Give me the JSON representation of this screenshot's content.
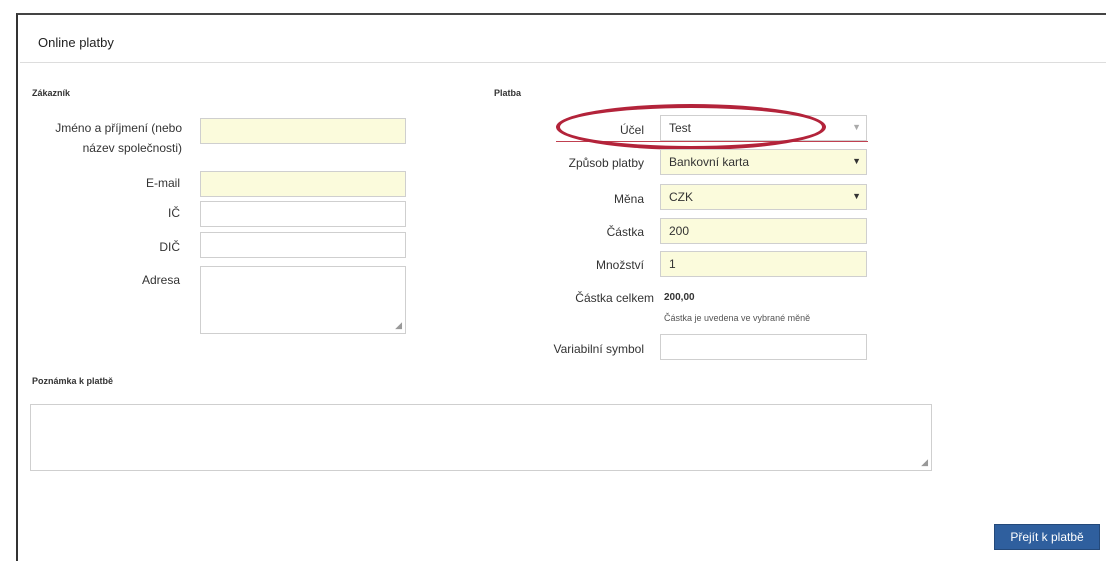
{
  "page": {
    "title": "Online platby"
  },
  "customer": {
    "section_title": "Zákazník",
    "name_label_line1": "Jméno a příjmení (nebo",
    "name_label_line2": "název společnosti)",
    "name_value": "",
    "email_label": "E-mail",
    "email_value": "",
    "ico_label": "IČ",
    "ico_value": "",
    "dic_label": "DIČ",
    "dic_value": "",
    "address_label": "Adresa",
    "address_value": ""
  },
  "payment": {
    "section_title": "Platba",
    "purpose_label": "Účel",
    "purpose_value": "Test",
    "method_label": "Způsob platby",
    "method_value": "Bankovní karta",
    "currency_label": "Měna",
    "currency_value": "CZK",
    "amount_label": "Částka",
    "amount_value": "200",
    "quantity_label": "Množství",
    "quantity_value": "1",
    "total_label": "Částka celkem",
    "total_value": "200,00",
    "total_hint": "Částka je uvedena ve vybrané měně",
    "varsymbol_label": "Variabilní symbol",
    "varsymbol_value": ""
  },
  "note": {
    "section_title": "Poznámka k platbě",
    "value": ""
  },
  "actions": {
    "submit_label": "Přejít k platbě"
  },
  "colors": {
    "highlight": "#b3233a",
    "required_field_bg": "#fbfbdc",
    "button_bg": "#2f5f9e"
  }
}
